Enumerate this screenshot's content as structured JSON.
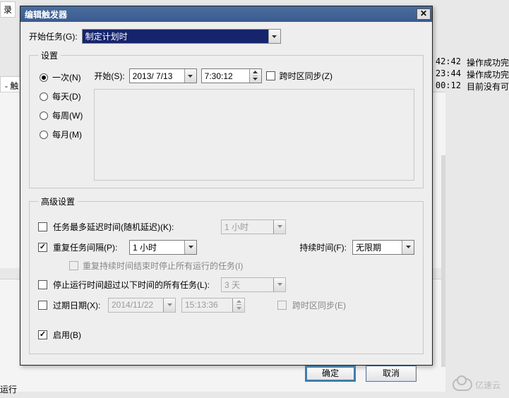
{
  "background": {
    "tab_record": "录",
    "tab_trigger": "- 触",
    "running": "运行",
    "rows": [
      {
        "time": "42:42",
        "msg": "操作成功完"
      },
      {
        "time": "23:44",
        "msg": "操作成功完"
      },
      {
        "time": "00:12",
        "msg": "目前没有可"
      }
    ],
    "watermark": "亿速云"
  },
  "dialog": {
    "title": "编辑触发器",
    "close": "✕",
    "begin_task_label": "开始任务(G):",
    "begin_task_value": "制定计划时",
    "settings_legend": "设置",
    "radios": {
      "once": "一次(N)",
      "daily": "每天(D)",
      "weekly": "每周(W)",
      "monthly": "每月(M)"
    },
    "start_label": "开始(S):",
    "start_date": "2013/ 7/13",
    "start_time": "7:30:12",
    "tz_sync": "跨时区同步(Z)",
    "advanced_legend": "高级设置",
    "delay_label": "任务最多延迟时间(随机延迟)(K):",
    "delay_value": "1 小时",
    "repeat_label": "重复任务间隔(P):",
    "repeat_value": "1 小时",
    "duration_label": "持续时间(F):",
    "duration_value": "无限期",
    "stop_after_repeat": "重复持续时间结束时停止所有运行的任务(I)",
    "stop_if_longer": "停止运行时间超过以下时间的所有任务(L):",
    "stop_if_value": "3 天",
    "expire_label": "过期日期(X):",
    "expire_date": "2014/11/22",
    "expire_time": "15:13:36",
    "tz_sync2": "跨时区同步(E)",
    "enabled": "启用(B)",
    "ok": "确定",
    "cancel": "取消"
  }
}
